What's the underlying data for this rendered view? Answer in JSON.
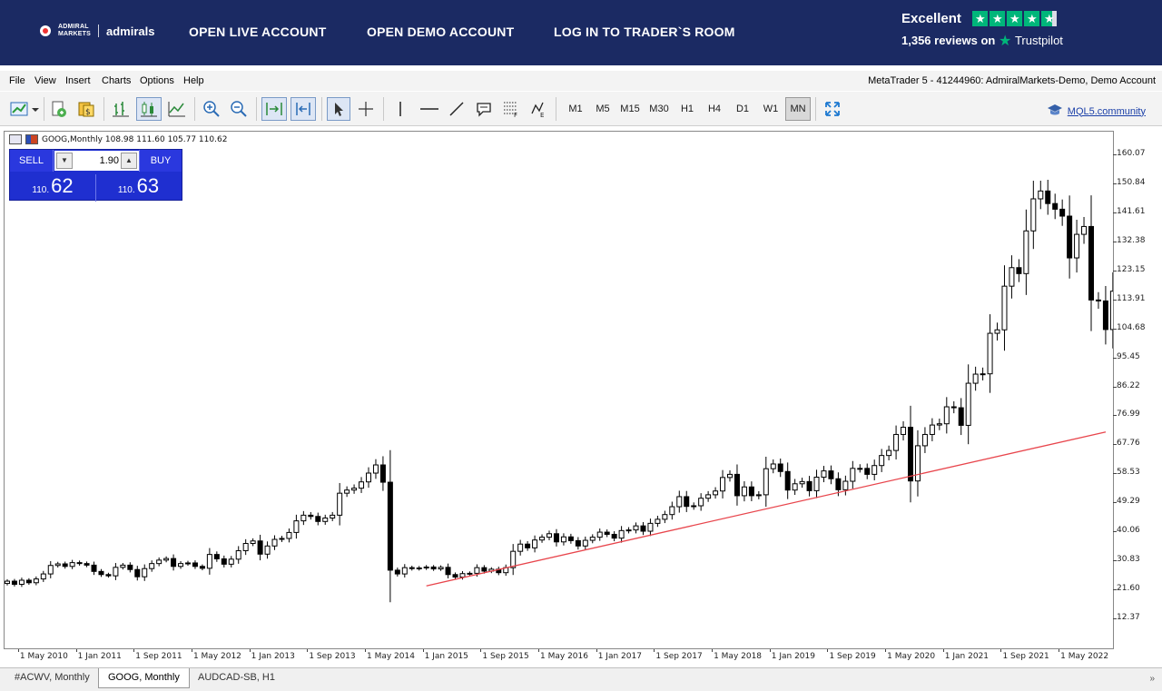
{
  "banner": {
    "logo_small_1": "ADMIRAL",
    "logo_small_2": "MARKETS",
    "logo_word": "admirals",
    "nav": [
      "OPEN LIVE ACCOUNT",
      "OPEN DEMO ACCOUNT",
      "LOG IN TO TRADER`S ROOM"
    ],
    "trust_rating": "Excellent",
    "trust_reviews": "1,356 reviews on",
    "trust_brand": "Trustpilot",
    "trust_star_color": "#00b67a"
  },
  "menu": {
    "items": [
      "File",
      "View",
      "Insert",
      "Charts",
      "Options",
      "Help"
    ],
    "account_info": "MetaTrader 5 - 41244960: AdmiralMarkets-Demo, Demo Account"
  },
  "toolbar": {
    "icons": [
      "new-chart-icon",
      "profiles-icon",
      "market-watch-icon",
      "data-window-icon",
      "bar-chart-icon",
      "candlestick-icon",
      "line-chart-icon",
      "zoom-in-icon",
      "zoom-out-icon",
      "auto-scroll-icon",
      "chart-shift-icon",
      "cursor-icon",
      "crosshair-icon",
      "vertical-line-icon",
      "horizontal-line-icon",
      "trendline-icon",
      "text-icon",
      "fibonacci-icon",
      "elliott-icon",
      "fullscreen-icon"
    ],
    "timeframes": [
      "M1",
      "M5",
      "M15",
      "M30",
      "H1",
      "H4",
      "D1",
      "W1",
      "MN"
    ],
    "active_timeframe": "MN",
    "community_link": "MQL5.community"
  },
  "chart": {
    "header": "GOOG,Monthly  108.98 111.60 105.77 110.62",
    "trade_panel": {
      "sell_label": "SELL",
      "buy_label": "BUY",
      "volume": "1.90",
      "sell_price_prefix": "110.",
      "sell_price_main": "62",
      "buy_price_prefix": "110.",
      "buy_price_main": "63"
    }
  },
  "chart_data": {
    "type": "candlestick",
    "symbol": "GOOG",
    "timeframe": "Monthly",
    "ohlc_last": {
      "open": 108.98,
      "high": 111.6,
      "low": 105.77,
      "close": 110.62
    },
    "y_ticks": [
      "160.07",
      "150.84",
      "141.61",
      "132.38",
      "123.15",
      "113.91",
      "104.68",
      "95.45",
      "86.22",
      "76.99",
      "67.76",
      "58.53",
      "49.29",
      "40.06",
      "30.83",
      "21.60",
      "12.37"
    ],
    "ylim": [
      5.0,
      165.0
    ],
    "x_ticks": [
      "1 May 2010",
      "1 Jan 2011",
      "1 Sep 2011",
      "1 May 2012",
      "1 Jan 2013",
      "1 Sep 2013",
      "1 May 2014",
      "1 Jan 2015",
      "1 Sep 2015",
      "1 May 2016",
      "1 Jan 2017",
      "1 Sep 2017",
      "1 May 2018",
      "1 Jan 2019",
      "1 Sep 2019",
      "1 May 2020",
      "1 Jan 2021",
      "1 Sep 2021",
      "1 May 2022"
    ],
    "closes": [
      24.5,
      23.5,
      24.8,
      24.0,
      25.2,
      26.8,
      29.5,
      30.0,
      29.2,
      30.4,
      30.1,
      29.6,
      27.6,
      26.6,
      26.2,
      28.9,
      29.6,
      28.2,
      25.9,
      28.5,
      30.1,
      31.2,
      31.7,
      29.2,
      30.1,
      30.3,
      29.2,
      28.6,
      33.0,
      31.6,
      29.9,
      31.5,
      34.2,
      36.5,
      37.3,
      33.1,
      35.7,
      37.8,
      38.1,
      40.0,
      43.7,
      45.5,
      45.1,
      43.5,
      44.6,
      45.5,
      52.5,
      53.5,
      54.1,
      56.1,
      58.9,
      61.5,
      56.0,
      28.0,
      26.8,
      28.8,
      28.5,
      28.7,
      29.0,
      28.4,
      28.9,
      26.6,
      25.8,
      26.9,
      27.0,
      28.8,
      27.7,
      28.3,
      27.2,
      28.8,
      34.0,
      36.3,
      35.1,
      37.6,
      38.5,
      39.6,
      37.0,
      38.6,
      37.4,
      35.7,
      37.5,
      38.5,
      40.1,
      39.4,
      38.2,
      40.6,
      40.8,
      42.1,
      40.4,
      42.9,
      44.2,
      45.7,
      48.2,
      51.4,
      48.3,
      48.5,
      50.9,
      52.0,
      53.2,
      57.5,
      58.5,
      51.7,
      54.5,
      51.7,
      52.0,
      60.3,
      61.8,
      59.4,
      53.5,
      55.5,
      56.2,
      53.3,
      57.6,
      59.6,
      57.1,
      53.6,
      56.3,
      60.4,
      60.4,
      58.5,
      61.3,
      64.5,
      66.1,
      71.2,
      73.5,
      56.4,
      67.6,
      71.2,
      74.2,
      74.6,
      80.0,
      79.7,
      74.1,
      87.5,
      90.4,
      90.5,
      103.4,
      104.5,
      118.4,
      124.3,
      122.4,
      136.0,
      146.2,
      148.7,
      144.7,
      142.9,
      140.7,
      127.4,
      134.9,
      137.4,
      114.0,
      113.7,
      104.6,
      116.8,
      110.6
    ],
    "trendline": {
      "from_date": "1 Jan 2015",
      "from_price": 23.0,
      "to_date": "1 Oct 2022",
      "to_price": 72.0,
      "color": "#e8454c"
    },
    "grid": false
  },
  "tabs": {
    "items": [
      "#ACWV, Monthly",
      "GOOG, Monthly",
      "AUDCAD-SB, H1"
    ],
    "active": "GOOG, Monthly",
    "overflow": "»"
  },
  "colors": {
    "banner_bg": "#1b2a63",
    "trade_panel_bg": "#1f2fd0",
    "bullish_candle": "#ffffff",
    "bearish_candle": "#000000"
  }
}
